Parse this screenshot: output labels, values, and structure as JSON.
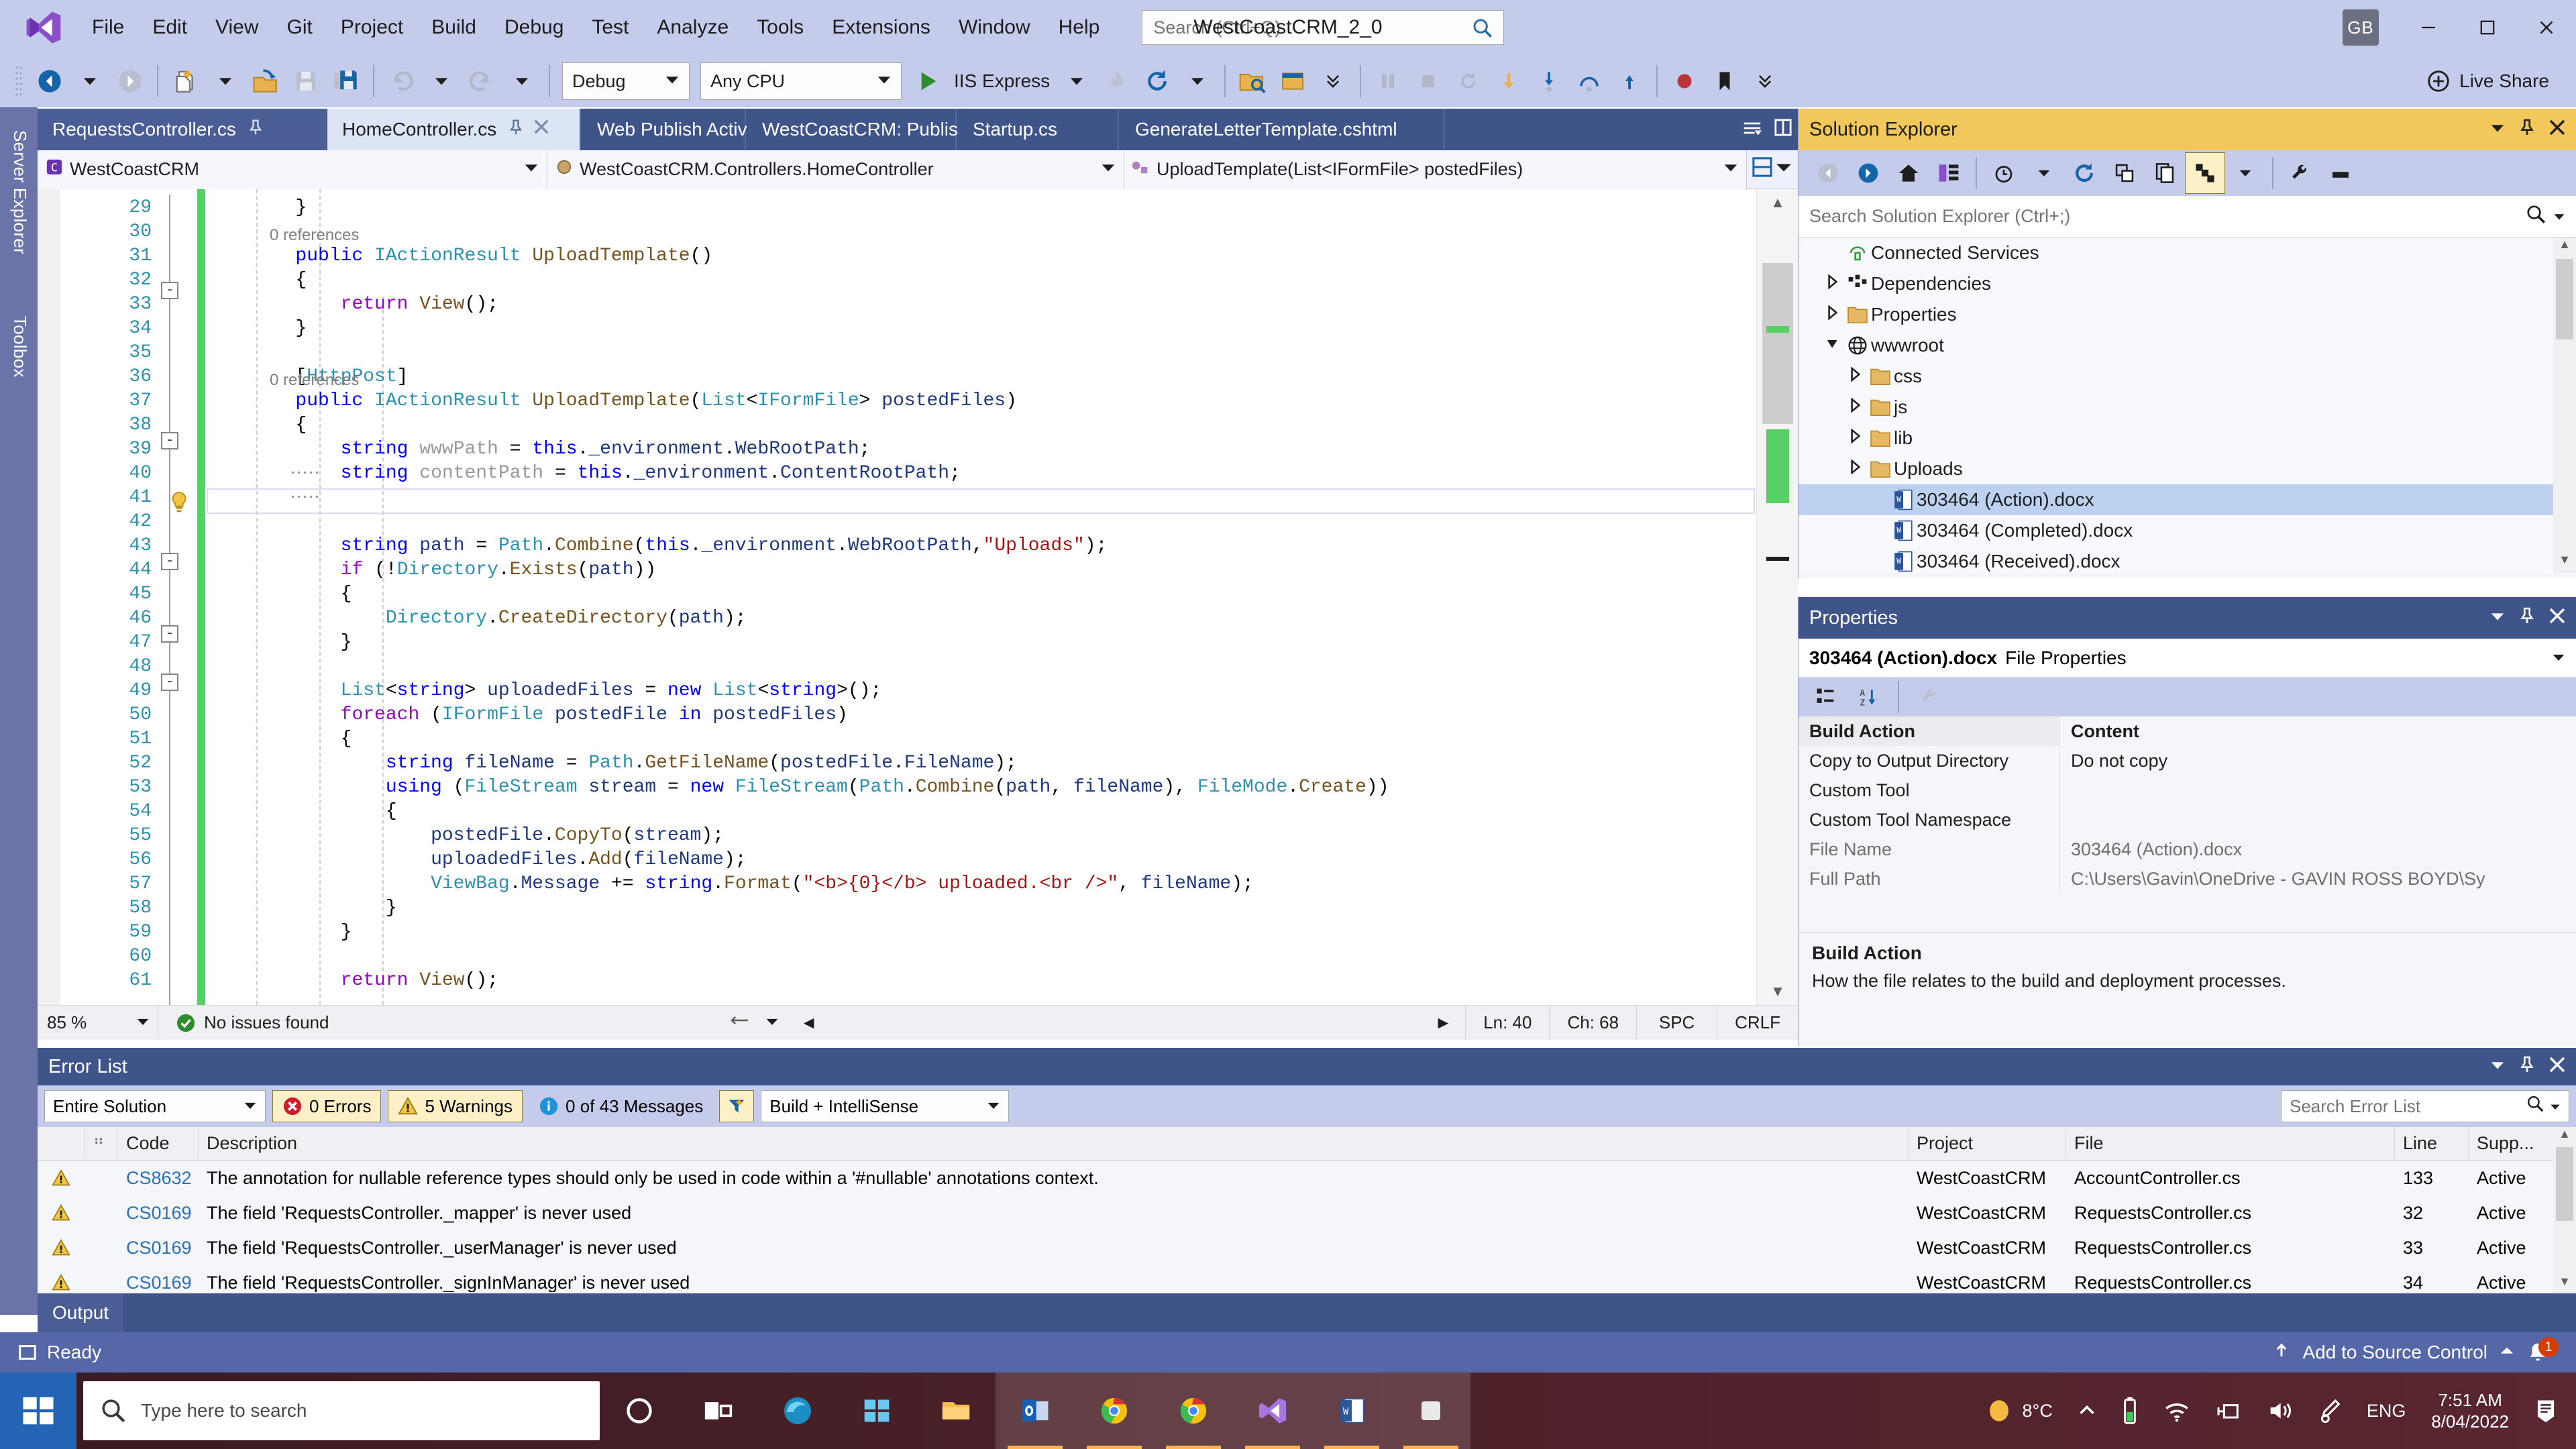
{
  "window": {
    "title": "WestCoastCRM_2_0",
    "avatar": "GB"
  },
  "menu": {
    "items": [
      "File",
      "Edit",
      "View",
      "Git",
      "Project",
      "Build",
      "Debug",
      "Test",
      "Analyze",
      "Tools",
      "Extensions",
      "Window",
      "Help"
    ],
    "quick_launch_placeholder": "Search (Ctrl+Q)"
  },
  "toolbar": {
    "configuration": "Debug",
    "platform": "Any CPU",
    "start_target": "IIS Express",
    "live_share": "Live Share"
  },
  "tabs": [
    {
      "label": "RequestsController.cs",
      "active": false,
      "pinned": true,
      "closable": false
    },
    {
      "label": "HomeController.cs",
      "active": true,
      "pinned": true,
      "closable": true
    },
    {
      "label": "Web Publish Activity",
      "active": false,
      "pinned": false,
      "closable": false
    },
    {
      "label": "WestCoastCRM: Publish",
      "active": false,
      "pinned": false,
      "closable": false
    },
    {
      "label": "Startup.cs",
      "active": false,
      "pinned": false,
      "closable": false
    },
    {
      "label": "GenerateLetterTemplate.cshtml",
      "active": false,
      "pinned": false,
      "closable": false
    }
  ],
  "navbar": {
    "project": "WestCoastCRM",
    "type": "WestCoastCRM.Controllers.HomeController",
    "member": "UploadTemplate(List<IFormFile> postedFiles)"
  },
  "editor": {
    "first_line": 29,
    "lines": [
      {
        "n": 29,
        "text": "        }"
      },
      {
        "n": 30,
        "text": ""
      },
      {
        "n": 31,
        "text": "        public IActionResult UploadTemplate()",
        "lens": "0 references"
      },
      {
        "n": 32,
        "text": "        {"
      },
      {
        "n": 33,
        "text": "            return View();"
      },
      {
        "n": 34,
        "text": "        }"
      },
      {
        "n": 35,
        "text": ""
      },
      {
        "n": 36,
        "text": "        [HttpPost]"
      },
      {
        "n": 37,
        "text": "        public IActionResult UploadTemplate(List<IFormFile> postedFiles)",
        "lens": "0 references"
      },
      {
        "n": 38,
        "text": "        {"
      },
      {
        "n": 39,
        "text": "            string wwwPath = this._environment.WebRootPath;"
      },
      {
        "n": 40,
        "text": "            string contentPath = this._environment.ContentRootPath;"
      },
      {
        "n": 41,
        "text": ""
      },
      {
        "n": 42,
        "text": ""
      },
      {
        "n": 43,
        "text": "            string path = Path.Combine(this._environment.WebRootPath,\"Uploads\");"
      },
      {
        "n": 44,
        "text": "            if (!Directory.Exists(path))"
      },
      {
        "n": 45,
        "text": "            {"
      },
      {
        "n": 46,
        "text": "                Directory.CreateDirectory(path);"
      },
      {
        "n": 47,
        "text": "            }"
      },
      {
        "n": 48,
        "text": ""
      },
      {
        "n": 49,
        "text": "            List<string> uploadedFiles = new List<string>();"
      },
      {
        "n": 50,
        "text": "            foreach (IFormFile postedFile in postedFiles)"
      },
      {
        "n": 51,
        "text": "            {"
      },
      {
        "n": 52,
        "text": "                string fileName = Path.GetFileName(postedFile.FileName);"
      },
      {
        "n": 53,
        "text": "                using (FileStream stream = new FileStream(Path.Combine(path, fileName), FileMode.Create))"
      },
      {
        "n": 54,
        "text": "                {"
      },
      {
        "n": 55,
        "text": "                    postedFile.CopyTo(stream);"
      },
      {
        "n": 56,
        "text": "                    uploadedFiles.Add(fileName);"
      },
      {
        "n": 57,
        "text": "                    ViewBag.Message += string.Format(\"<b>{0}</b> uploaded.<br />\", fileName);"
      },
      {
        "n": 58,
        "text": "                }"
      },
      {
        "n": 59,
        "text": "            }"
      },
      {
        "n": 60,
        "text": ""
      },
      {
        "n": 61,
        "text": "            return View();"
      }
    ],
    "caret_line": 40,
    "status": {
      "zoom": "85 %",
      "issues": "No issues found",
      "line_label": "Ln: 40",
      "col_label": "Ch: 68",
      "spaces": "SPC",
      "eol": "CRLF"
    }
  },
  "solution_explorer": {
    "title": "Solution Explorer",
    "search_placeholder": "Search Solution Explorer (Ctrl+;)",
    "tree": [
      {
        "label": "Connected Services",
        "depth": 1,
        "arrow": "none",
        "icon": "connected-services-icon",
        "selected": false
      },
      {
        "label": "Dependencies",
        "depth": 1,
        "arrow": "collapsed",
        "icon": "dependencies-icon",
        "selected": false
      },
      {
        "label": "Properties",
        "depth": 1,
        "arrow": "collapsed",
        "icon": "properties-folder-icon",
        "selected": false
      },
      {
        "label": "wwwroot",
        "depth": 1,
        "arrow": "expanded",
        "icon": "wwwroot-globe-icon",
        "selected": false
      },
      {
        "label": "css",
        "depth": 2,
        "arrow": "collapsed",
        "icon": "folder-icon",
        "selected": false
      },
      {
        "label": "js",
        "depth": 2,
        "arrow": "collapsed",
        "icon": "folder-icon",
        "selected": false
      },
      {
        "label": "lib",
        "depth": 2,
        "arrow": "collapsed",
        "icon": "folder-icon",
        "selected": false
      },
      {
        "label": "Uploads",
        "depth": 2,
        "arrow": "collapsed",
        "icon": "folder-icon",
        "selected": false
      },
      {
        "label": "303464 (Action).docx",
        "depth": 3,
        "arrow": "none",
        "icon": "word-doc-icon",
        "selected": true
      },
      {
        "label": "303464 (Completed).docx",
        "depth": 3,
        "arrow": "none",
        "icon": "word-doc-icon",
        "selected": false
      },
      {
        "label": "303464 (Received).docx",
        "depth": 3,
        "arrow": "none",
        "icon": "word-doc-icon",
        "selected": false
      }
    ]
  },
  "properties": {
    "title": "Properties",
    "object_name": "303464 (Action).docx",
    "object_kind": "File Properties",
    "rows": [
      {
        "name": "Build Action",
        "value": "Content",
        "bold": true,
        "dim": false
      },
      {
        "name": "Copy to Output Directory",
        "value": "Do not copy",
        "bold": false,
        "dim": false
      },
      {
        "name": "Custom Tool",
        "value": "",
        "bold": false,
        "dim": false
      },
      {
        "name": "Custom Tool Namespace",
        "value": "",
        "bold": false,
        "dim": false
      },
      {
        "name": "File Name",
        "value": "303464 (Action).docx",
        "bold": false,
        "dim": true
      },
      {
        "name": "Full Path",
        "value": "C:\\Users\\Gavin\\OneDrive - GAVIN ROSS BOYD\\Sy",
        "bold": false,
        "dim": true
      }
    ],
    "description_title": "Build Action",
    "description_body": "How the file relates to the build and deployment processes."
  },
  "error_list": {
    "title": "Error List",
    "scope": "Entire Solution",
    "errors_label": "0 Errors",
    "warnings_label": "5 Warnings",
    "messages_label": "0 of 43 Messages",
    "build_filter": "Build + IntelliSense",
    "search_placeholder": "Search Error List",
    "columns": [
      "",
      "",
      "Code",
      "Description",
      "Project",
      "File",
      "Line",
      "Supp..."
    ],
    "rows": [
      {
        "severity": "warning",
        "code": "CS8632",
        "description": "The annotation for nullable reference types should only be used in code within a '#nullable' annotations context.",
        "project": "WestCoastCRM",
        "file": "AccountController.cs",
        "line": "133",
        "suppression": "Active"
      },
      {
        "severity": "warning",
        "code": "CS0169",
        "description": "The field 'RequestsController._mapper' is never used",
        "project": "WestCoastCRM",
        "file": "RequestsController.cs",
        "line": "32",
        "suppression": "Active"
      },
      {
        "severity": "warning",
        "code": "CS0169",
        "description": "The field 'RequestsController._userManager' is never used",
        "project": "WestCoastCRM",
        "file": "RequestsController.cs",
        "line": "33",
        "suppression": "Active"
      },
      {
        "severity": "warning",
        "code": "CS0169",
        "description": "The field 'RequestsController._signInManager' is never used",
        "project": "WestCoastCRM",
        "file": "RequestsController.cs",
        "line": "34",
        "suppression": "Active"
      }
    ]
  },
  "output_tab": {
    "label": "Output"
  },
  "status_bar": {
    "ready": "Ready",
    "source_control": "Add to Source Control",
    "notification_count": "1"
  },
  "left_rail": {
    "items": [
      "Server Explorer",
      "Toolbox"
    ]
  },
  "taskbar": {
    "search_placeholder": "Type here to search",
    "weather_temp": "8°C",
    "language": "ENG",
    "time": "7:51 AM",
    "date": "8/04/2022"
  },
  "colors": {
    "menu_bg": "#c5cbea",
    "tab_bg": "#3f5589",
    "accent_orange": "#f2c75c",
    "status_bg": "#5667a8",
    "selection_blue": "#bcd2f0",
    "change_bar_green": "#57d064"
  }
}
